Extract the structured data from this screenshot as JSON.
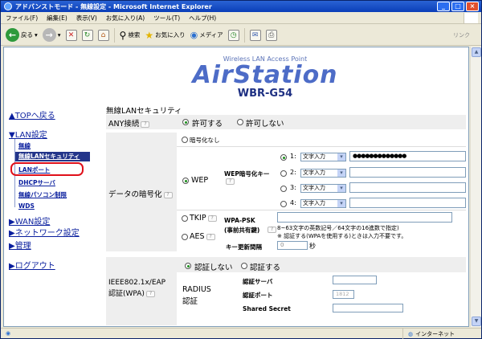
{
  "window": {
    "title": "アドバンストモード - 無線設定 - Microsoft Internet Explorer",
    "min": "_",
    "max": "□",
    "close": "×"
  },
  "menu": [
    "ファイル(F)",
    "編集(E)",
    "表示(V)",
    "お気に入り(A)",
    "ツール(T)",
    "ヘルプ(H)"
  ],
  "toolbar": {
    "back": "戻る",
    "search": "検索",
    "favorites": "お気に入り",
    "media": "メディア",
    "links": "リンク"
  },
  "status": {
    "zone": "インターネット"
  },
  "logo": {
    "sub": "Wireless LAN Access Point",
    "main": "AirStation",
    "model": "WBR-G54"
  },
  "nav": {
    "top": "▲TOPへ戻る",
    "lan": "▼LAN設定",
    "wireless": "無線",
    "wsec": "無線LANセキュリティ",
    "lanport": "LANポート",
    "dhcp": "DHCPサーバ",
    "pcrestrict": "無線パソコン制限",
    "wds": "WDS",
    "wan": "▶WAN設定",
    "network": "▶ネットワーク設定",
    "admin": "▶管理",
    "log": "▶ログアウト"
  },
  "content": {
    "heading": "無線LANセキュリティ",
    "any": {
      "label": "ANY接続",
      "allow": "許可する",
      "deny": "許可しない"
    },
    "enc": {
      "label": "データの暗号化",
      "none": "暗号化なし",
      "wep": "WEP",
      "wep_key_label": "WEP暗号化キー",
      "tkip": "TKIP",
      "aes": "AES",
      "keys": [
        {
          "n": "1:",
          "type": "文字入力",
          "value": "●●●●●●●●●●●●●"
        },
        {
          "n": "2:",
          "type": "文字入力",
          "value": ""
        },
        {
          "n": "3:",
          "type": "文字入力",
          "value": ""
        },
        {
          "n": "4:",
          "type": "文字入力",
          "value": ""
        }
      ],
      "psk_label": "WPA-PSK",
      "psk_label2": "(事前共有鍵)",
      "psk_note1": "8~63文字の英数記号／64文字の16進数で指定)",
      "psk_note2": "※ 認証する(WPAを使用する)ときは入力不要です。",
      "interval_label": "キー更新間隔",
      "interval_value": "0",
      "interval_unit": "秒"
    },
    "ieee": {
      "label": "IEEE802.1x/EAP",
      "label2": "認証(WPA)",
      "off": "認証しない",
      "on": "認証する",
      "radius": "RADIUS",
      "radius2": "認証",
      "server": "認証サーバ",
      "port": "認証ポート",
      "port_value": "1812",
      "secret": "Shared Secret"
    }
  }
}
